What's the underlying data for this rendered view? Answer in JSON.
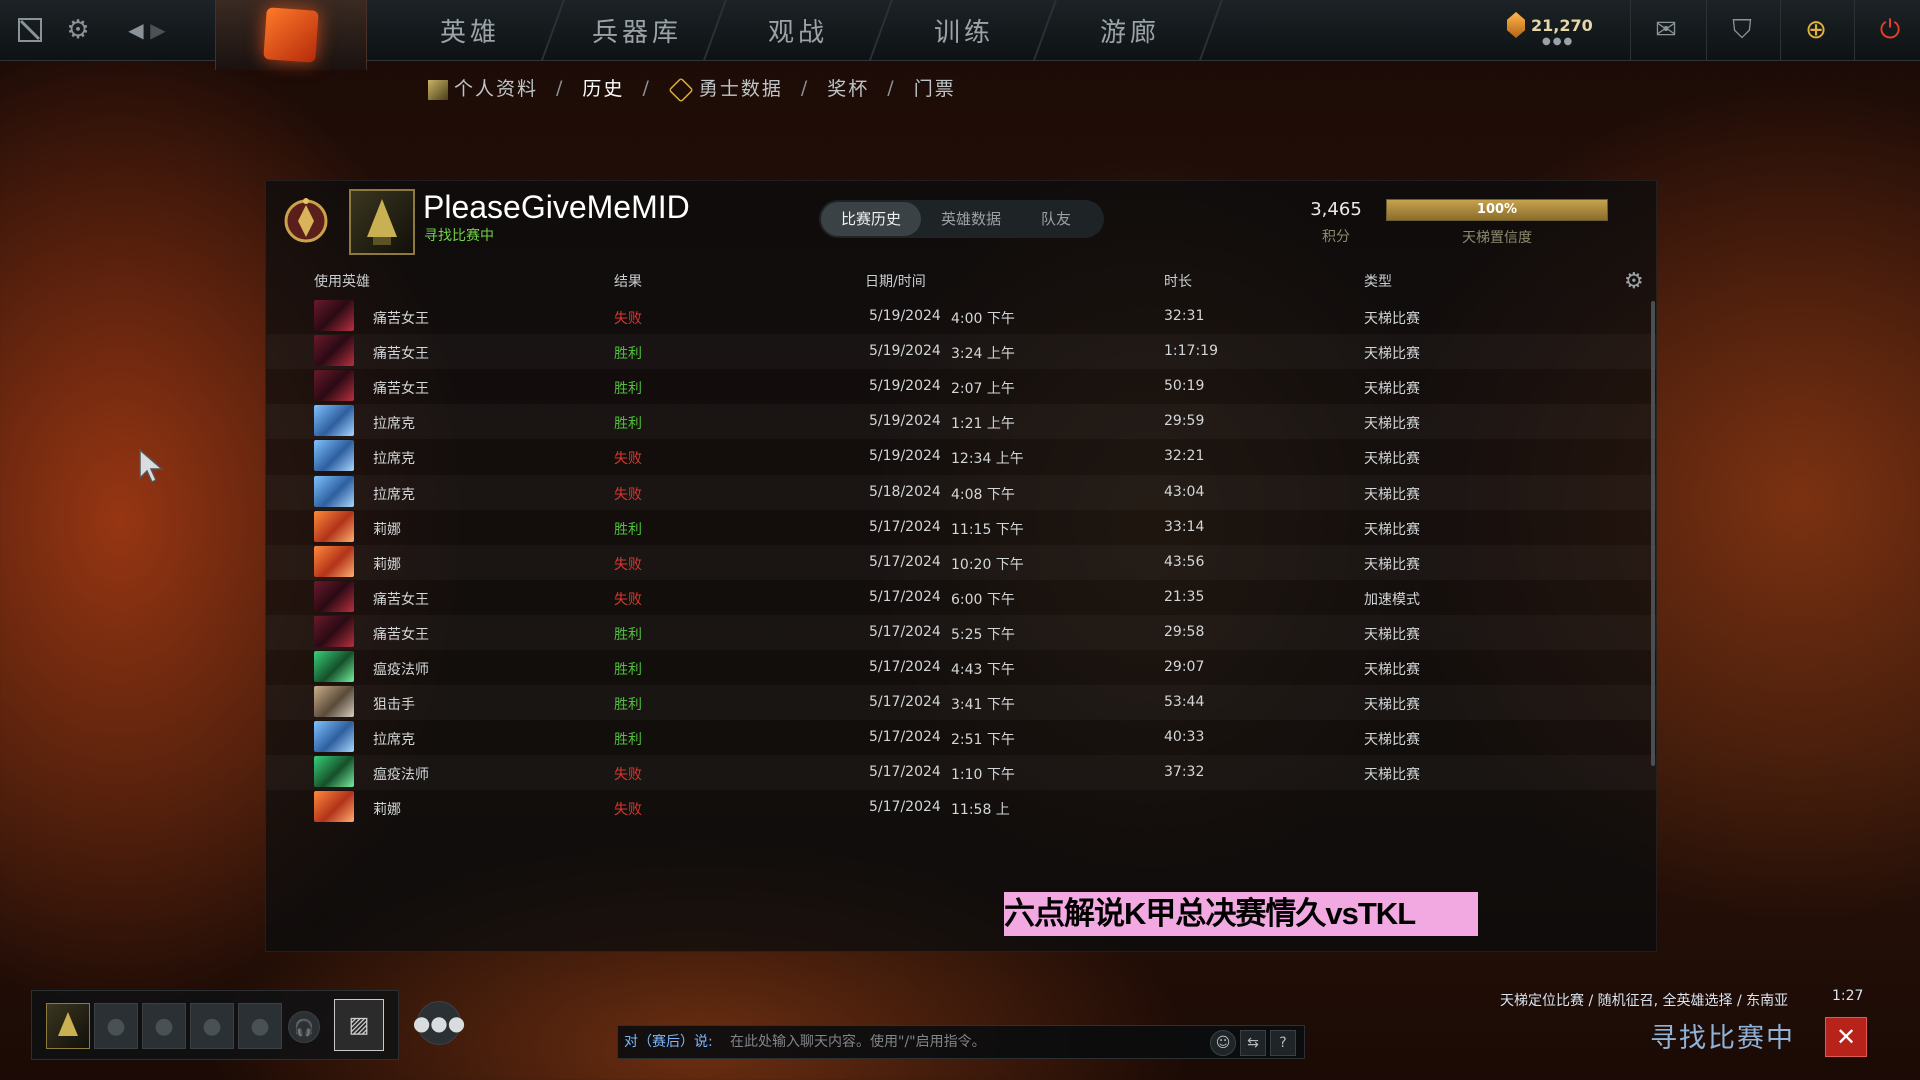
{
  "top_nav": {
    "tabs": [
      "英雄",
      "兵器库",
      "观战",
      "训练",
      "游廊"
    ],
    "currency_value": "21,270"
  },
  "breadcrumb": {
    "items": [
      "个人资料",
      "历史",
      "勇士数据",
      "奖杯",
      "门票"
    ],
    "active": "历史"
  },
  "profile": {
    "name": "PleaseGiveMeMID",
    "status": "寻找比赛中",
    "tabs": [
      "比赛历史",
      "英雄数据",
      "队友"
    ],
    "active_tab": "比赛历史",
    "score_value": "3,465",
    "score_label": "积分",
    "confidence_value": "100%",
    "confidence_fraction": 1.0,
    "confidence_label": "天梯置信度"
  },
  "table": {
    "headers": [
      "使用英雄",
      "结果",
      "日期/时间",
      "时长",
      "类型"
    ],
    "rows": [
      {
        "hero": "痛苦女王",
        "result": "失败",
        "date": "5/19/2024",
        "time": "4:00 下午",
        "duration": "32:31",
        "type": "天梯比赛",
        "icon": "queen-of-pain-icon"
      },
      {
        "hero": "痛苦女王",
        "result": "胜利",
        "date": "5/19/2024",
        "time": "3:24 上午",
        "duration": "1:17:19",
        "type": "天梯比赛",
        "icon": "queen-of-pain-icon"
      },
      {
        "hero": "痛苦女王",
        "result": "胜利",
        "date": "5/19/2024",
        "time": "2:07 上午",
        "duration": "50:19",
        "type": "天梯比赛",
        "icon": "queen-of-pain-icon"
      },
      {
        "hero": "拉席克",
        "result": "胜利",
        "date": "5/19/2024",
        "time": "1:21 上午",
        "duration": "29:59",
        "type": "天梯比赛",
        "icon": "leshrac-icon"
      },
      {
        "hero": "拉席克",
        "result": "失败",
        "date": "5/19/2024",
        "time": "12:34 上午",
        "duration": "32:21",
        "type": "天梯比赛",
        "icon": "leshrac-icon"
      },
      {
        "hero": "拉席克",
        "result": "失败",
        "date": "5/18/2024",
        "time": "4:08 下午",
        "duration": "43:04",
        "type": "天梯比赛",
        "icon": "leshrac-icon"
      },
      {
        "hero": "莉娜",
        "result": "胜利",
        "date": "5/17/2024",
        "time": "11:15 下午",
        "duration": "33:14",
        "type": "天梯比赛",
        "icon": "lina-icon"
      },
      {
        "hero": "莉娜",
        "result": "失败",
        "date": "5/17/2024",
        "time": "10:20 下午",
        "duration": "43:56",
        "type": "天梯比赛",
        "icon": "lina-icon"
      },
      {
        "hero": "痛苦女王",
        "result": "失败",
        "date": "5/17/2024",
        "time": "6:00 下午",
        "duration": "21:35",
        "type": "加速模式",
        "icon": "queen-of-pain-icon"
      },
      {
        "hero": "痛苦女王",
        "result": "胜利",
        "date": "5/17/2024",
        "time": "5:25 下午",
        "duration": "29:58",
        "type": "天梯比赛",
        "icon": "queen-of-pain-icon"
      },
      {
        "hero": "瘟疫法师",
        "result": "胜利",
        "date": "5/17/2024",
        "time": "4:43 下午",
        "duration": "29:07",
        "type": "天梯比赛",
        "icon": "necrophos-icon"
      },
      {
        "hero": "狙击手",
        "result": "胜利",
        "date": "5/17/2024",
        "time": "3:41 下午",
        "duration": "53:44",
        "type": "天梯比赛",
        "icon": "sniper-icon"
      },
      {
        "hero": "拉席克",
        "result": "胜利",
        "date": "5/17/2024",
        "time": "2:51 下午",
        "duration": "40:33",
        "type": "天梯比赛",
        "icon": "leshrac-icon"
      },
      {
        "hero": "瘟疫法师",
        "result": "失败",
        "date": "5/17/2024",
        "time": "1:10 下午",
        "duration": "37:32",
        "type": "天梯比赛",
        "icon": "necrophos-icon"
      },
      {
        "hero": "莉娜",
        "result": "失败",
        "date": "5/17/2024",
        "time": "11:58 上",
        "duration": "",
        "type": "",
        "icon": "lina-icon"
      }
    ]
  },
  "overlay_banner": "六点解说K甲总决赛情久vsTKL",
  "chat": {
    "label": "对（赛后）说:",
    "placeholder": "在此处输入聊天内容。使用\"/\"启用指令。",
    "help": "?"
  },
  "matchmaking": {
    "info": "天梯定位比赛 / 随机征召, 全英雄选择 / 东南亚",
    "time": "1:27",
    "status": "寻找比赛中",
    "cancel": "✕"
  },
  "colors": {
    "win": "#4fbf3c",
    "loss": "#d9382e",
    "status_green": "#6fd24a",
    "accent_gold": "#c6a24e",
    "banner_pink": "#f2a8e0"
  }
}
